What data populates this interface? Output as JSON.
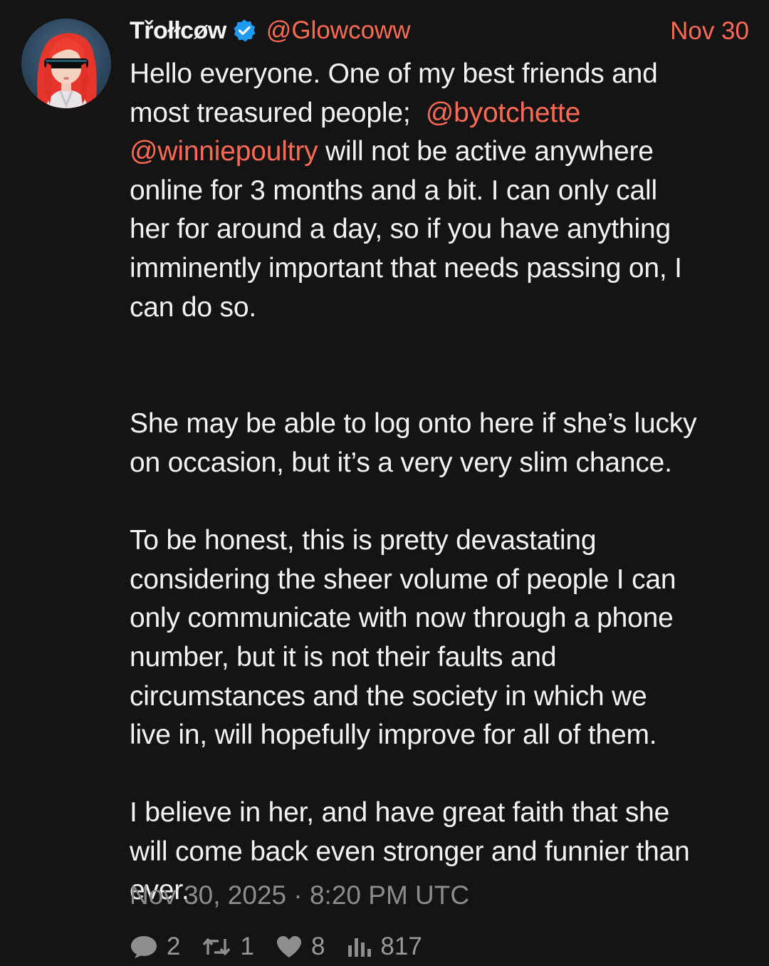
{
  "author": {
    "display_name": "Třołłcøw",
    "handle": "@Glowcoww",
    "verified": true,
    "avatar_icon": "avatar-redhair-visor"
  },
  "post": {
    "date_short": "Nov 30",
    "lines": [
      {
        "type": "text",
        "segments": [
          {
            "t": "Hello everyone. One of my best friends and"
          }
        ]
      },
      {
        "type": "text",
        "segments": [
          {
            "t": "most treasured people;  "
          },
          {
            "t": "@byotchette",
            "mention": true
          }
        ]
      },
      {
        "type": "text",
        "segments": [
          {
            "t": "@winniepoultry",
            "mention": true
          },
          {
            "t": " will not be active anywhere"
          }
        ]
      },
      {
        "type": "text",
        "segments": [
          {
            "t": "online for 3 months and a bit. I can only call"
          }
        ]
      },
      {
        "type": "text",
        "segments": [
          {
            "t": "her for around a day, so if you have anything"
          }
        ]
      },
      {
        "type": "text",
        "segments": [
          {
            "t": "imminently important that needs passing on, I"
          }
        ]
      },
      {
        "type": "text",
        "segments": [
          {
            "t": "can do so."
          }
        ]
      },
      {
        "type": "blank"
      },
      {
        "type": "blank"
      },
      {
        "type": "text",
        "segments": [
          {
            "t": "She may be able to log onto here if she’s lucky"
          }
        ]
      },
      {
        "type": "text",
        "segments": [
          {
            "t": "on occasion, but it’s a very very slim chance."
          }
        ]
      },
      {
        "type": "blank"
      },
      {
        "type": "text",
        "segments": [
          {
            "t": "To be honest, this is pretty devastating"
          }
        ]
      },
      {
        "type": "text",
        "segments": [
          {
            "t": "considering the sheer volume of people I can"
          }
        ]
      },
      {
        "type": "text",
        "segments": [
          {
            "t": "only communicate with now through a phone"
          }
        ]
      },
      {
        "type": "text",
        "segments": [
          {
            "t": "number, but it is not their faults and"
          }
        ]
      },
      {
        "type": "text",
        "segments": [
          {
            "t": "circumstances and the society in which we"
          }
        ]
      },
      {
        "type": "text",
        "segments": [
          {
            "t": "live in, will hopefully improve for all of them."
          }
        ]
      },
      {
        "type": "blank"
      },
      {
        "type": "text",
        "segments": [
          {
            "t": "I believe in her, and have great faith that she"
          }
        ]
      },
      {
        "type": "text",
        "segments": [
          {
            "t": "will come back even stronger and funnier than"
          }
        ]
      },
      {
        "type": "text",
        "segments": [
          {
            "t": "ever."
          }
        ]
      }
    ],
    "timestamp": "Nov 30, 2025 · 8:20 PM UTC"
  },
  "stats": {
    "replies": "2",
    "reposts": "1",
    "likes": "8",
    "views": "817"
  },
  "colors": {
    "background": "#141414",
    "accent": "#ff6a55",
    "muted": "#8c8c8c",
    "verified_badge": "#1d9bf0"
  }
}
